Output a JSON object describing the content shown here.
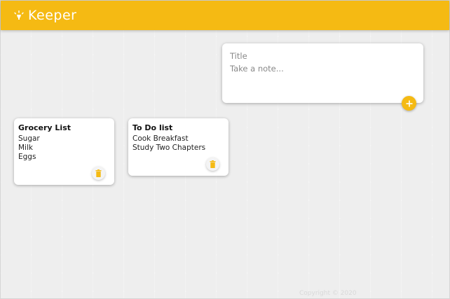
{
  "header": {
    "title": "Keeper",
    "logo_icon": "highlight-icon",
    "color": "#f5ba13"
  },
  "create_area": {
    "title_placeholder": "Title",
    "content_placeholder": "Take a note...",
    "add_icon": "plus-icon"
  },
  "notes": [
    {
      "title": "Grocery List",
      "content": "Sugar\nMilk\nEggs",
      "delete_icon": "trash-icon"
    },
    {
      "title": "To Do list",
      "content": "Cook Breakfast\nStudy Two Chapters",
      "delete_icon": "trash-icon"
    }
  ],
  "footer": {
    "text": "Copyright © 2020"
  }
}
